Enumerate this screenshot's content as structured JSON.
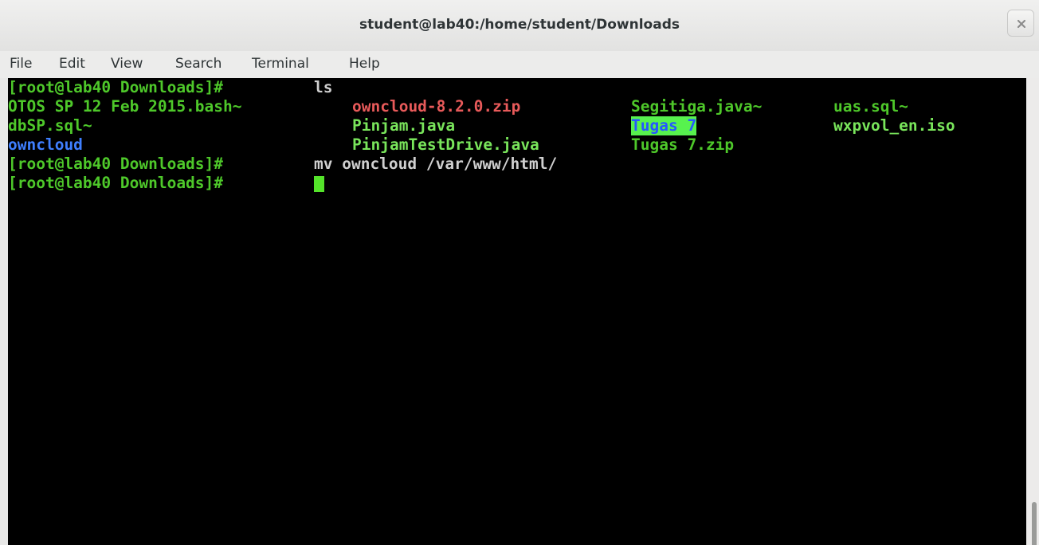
{
  "window": {
    "title": "student@lab40:/home/student/Downloads"
  },
  "menubar": {
    "items": [
      {
        "label": "File"
      },
      {
        "label": "Edit"
      },
      {
        "label": "View"
      },
      {
        "label": "Search"
      },
      {
        "label": "Terminal"
      },
      {
        "label": "Help"
      }
    ]
  },
  "terminal": {
    "prompt": "[root@lab40 Downloads]# ",
    "commands": [
      "ls",
      "mv owncloud /var/www/html/"
    ],
    "ls_output": {
      "rows": [
        [
          "OTOS SP 12 Feb 2015.bash~",
          "owncloud-8.2.0.zip",
          "Segitiga.java~",
          "uas.sql~"
        ],
        [
          "dbSP.sql~",
          "Pinjam.java",
          "Tugas 7",
          "wxpvol_en.iso"
        ],
        [
          "owncloud",
          "PinjamTestDrive.java",
          "Tugas 7.zip",
          ""
        ]
      ],
      "file_colors": {
        "regular": "#4ec82a",
        "archive": "#e85a5a",
        "directory": "#3f7fff",
        "highlighted_directory_bg": "#57f24e"
      }
    }
  },
  "icons": {
    "close": "close-x-icon"
  }
}
